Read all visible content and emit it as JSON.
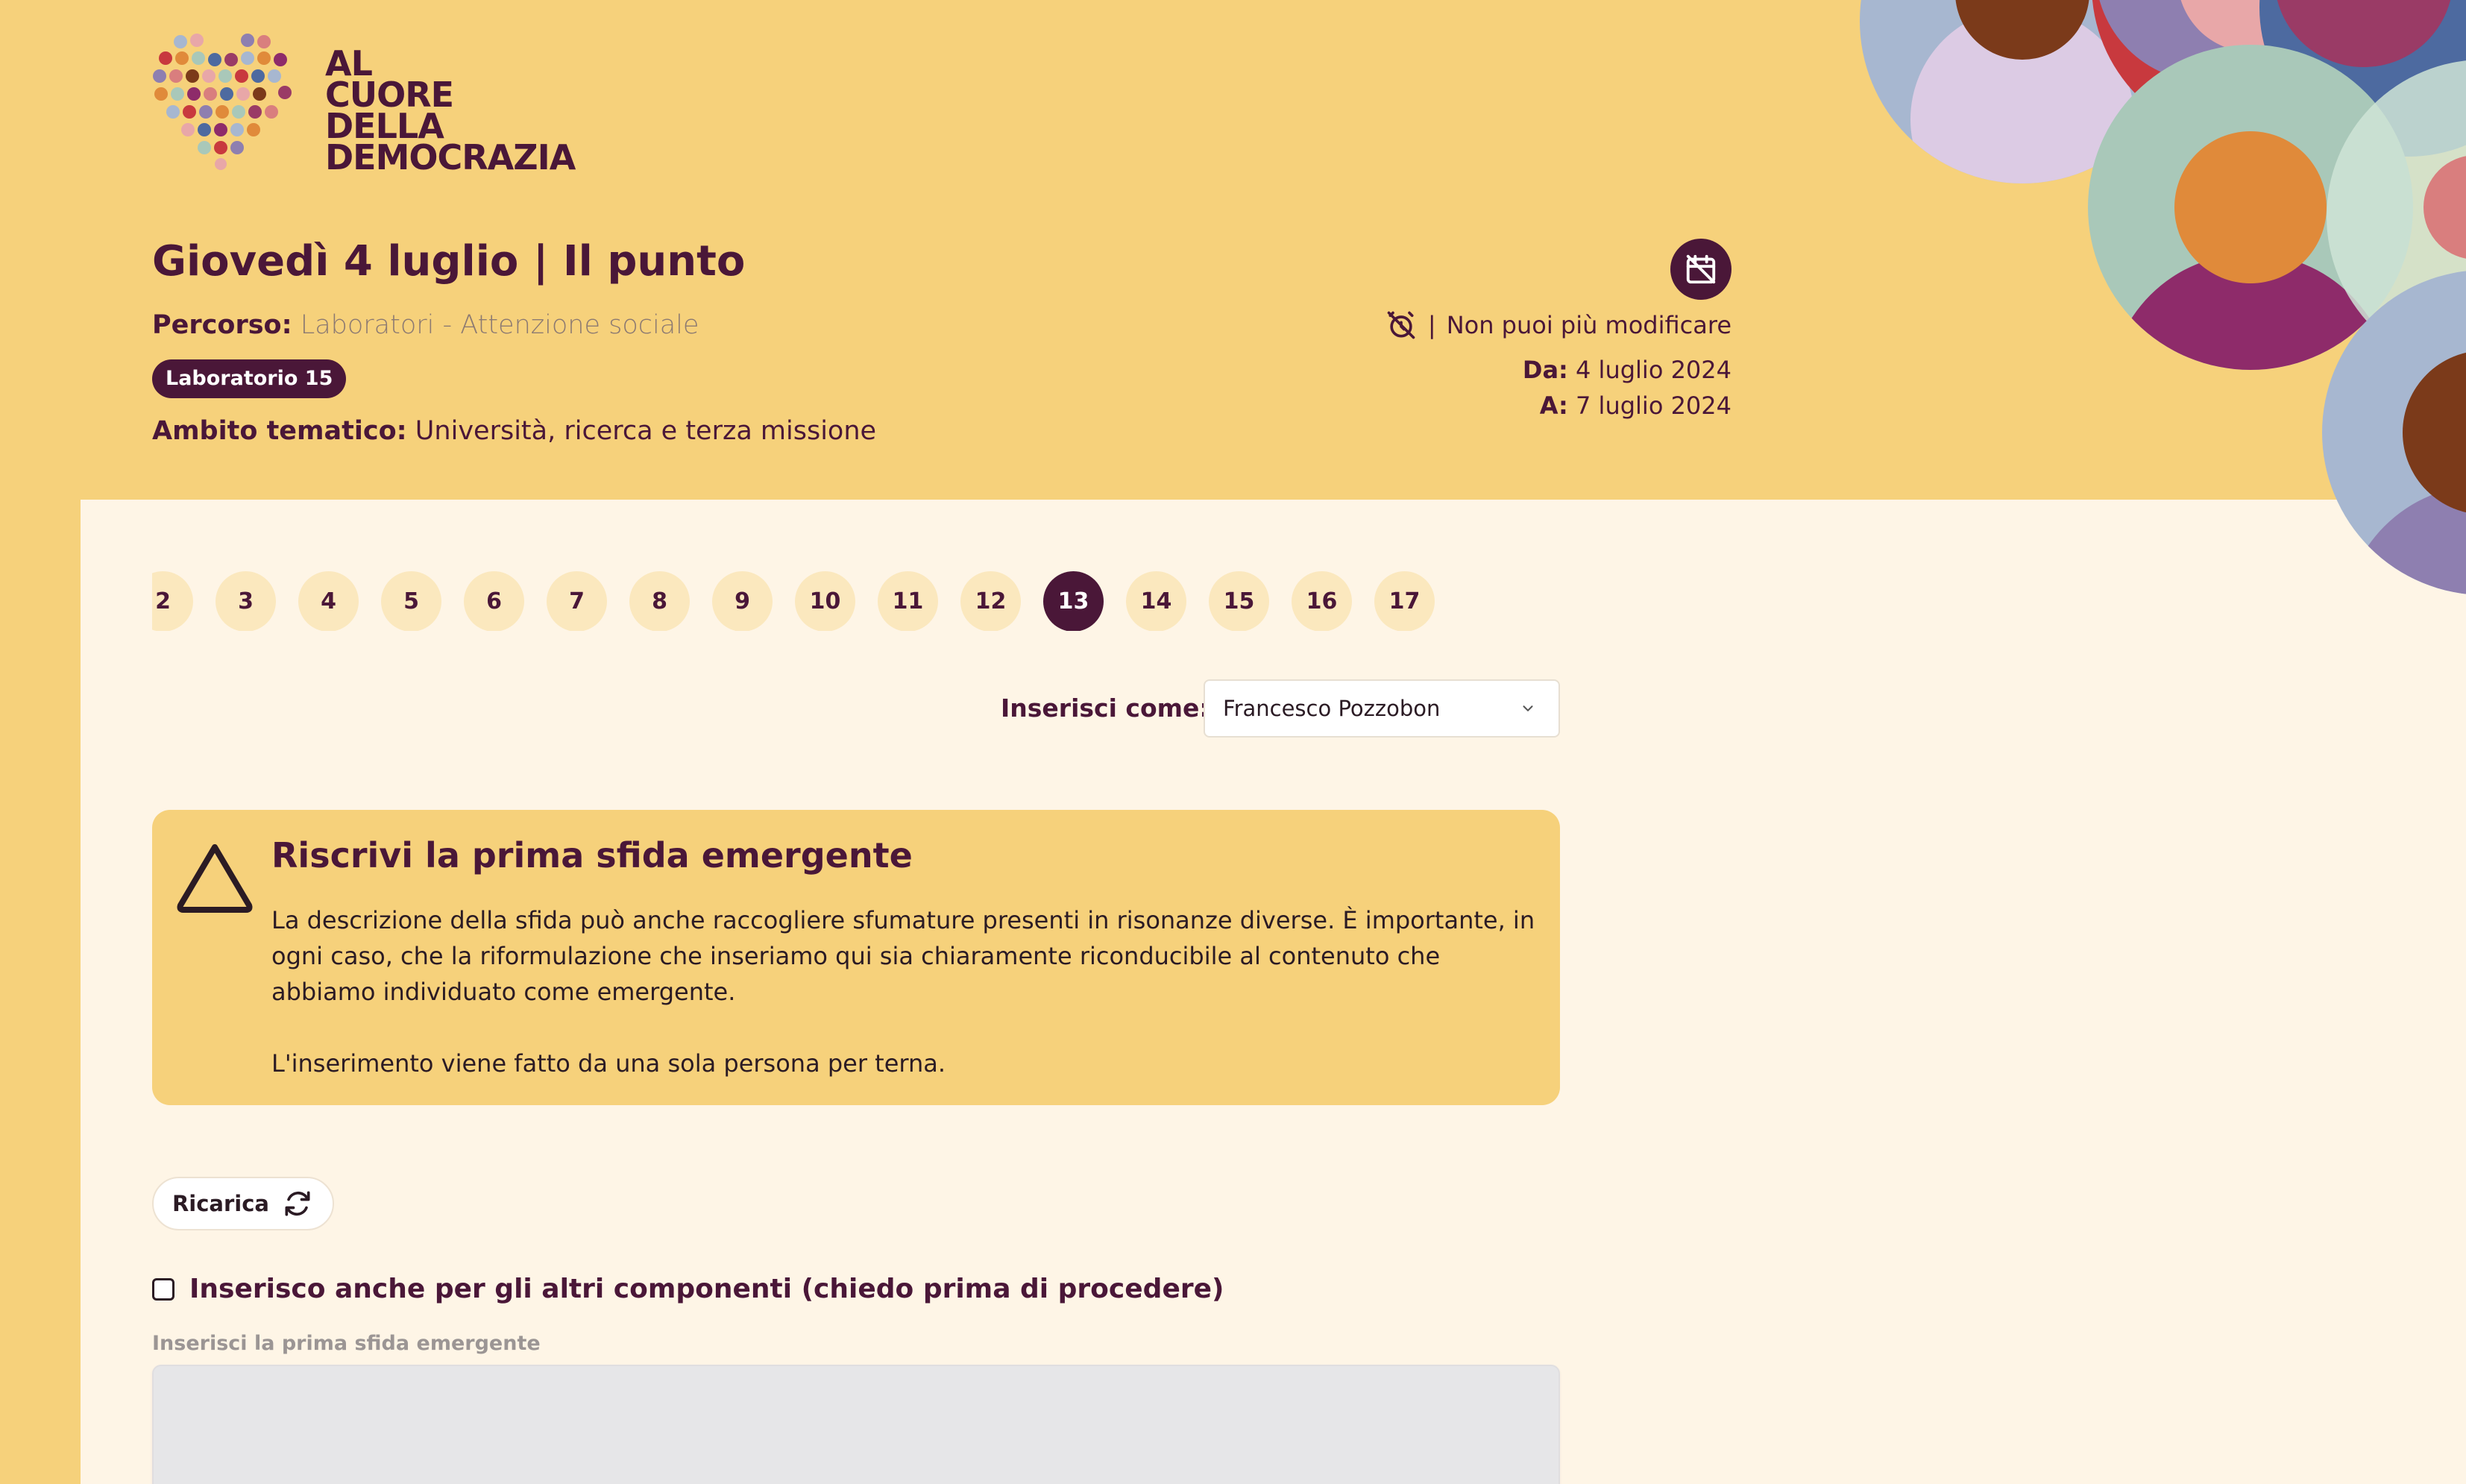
{
  "brand": {
    "logo_lines": [
      "AL",
      "CUORE",
      "DELLA",
      "DEMOCRAZIA"
    ]
  },
  "header": {
    "title": "Giovedì 4 luglio | Il punto",
    "percorso_label": "Percorso:",
    "percorso_value": "Laboratori - Attenzione sociale",
    "lab_badge": "Laboratorio 15",
    "ambito_label": "Ambito tematico:",
    "ambito_value": "Università, ricerca e terza missione",
    "status_separator": "|",
    "status_text": "Non puoi più modificare",
    "from_label": "Da:",
    "from_value": "4 luglio 2024",
    "to_label": "A:",
    "to_value": "7 luglio 2024"
  },
  "steps": {
    "items": [
      "2",
      "3",
      "4",
      "5",
      "6",
      "7",
      "8",
      "9",
      "10",
      "11",
      "12",
      "13",
      "14",
      "15",
      "16",
      "17"
    ],
    "active": "13"
  },
  "insert_as": {
    "label": "Inserisci come:",
    "selected": "Francesco Pozzobon"
  },
  "alert": {
    "title": "Riscrivi la prima sfida emergente",
    "paragraph1": "La descrizione della sfida può anche raccogliere sfumature presenti in risonanze diverse. È importante, in ogni caso, che la riformulazione che inseriamo qui sia chiaramente riconducibile al contenuto che abbiamo individuato come emergente.",
    "paragraph2": "L'inserimento viene fatto da una sola persona per terna."
  },
  "reload_label": "Ricarica",
  "checkbox_label": "Inserisco anche per gli altri componenti (chiedo prima di procedere)",
  "field_label": "Inserisci la prima sfida emergente",
  "colors": {
    "brand_dark": "#4A1738",
    "header_bg": "#F6D17B",
    "panel_bg": "#FEF5E6",
    "step_bg": "#FBE8BE"
  },
  "icons": {
    "calendar_off": "calendar-off-icon",
    "alarm_off": "alarm-off-icon",
    "warning": "warning-triangle-icon",
    "reload": "refresh-icon",
    "chevron": "chevron-down-icon"
  }
}
